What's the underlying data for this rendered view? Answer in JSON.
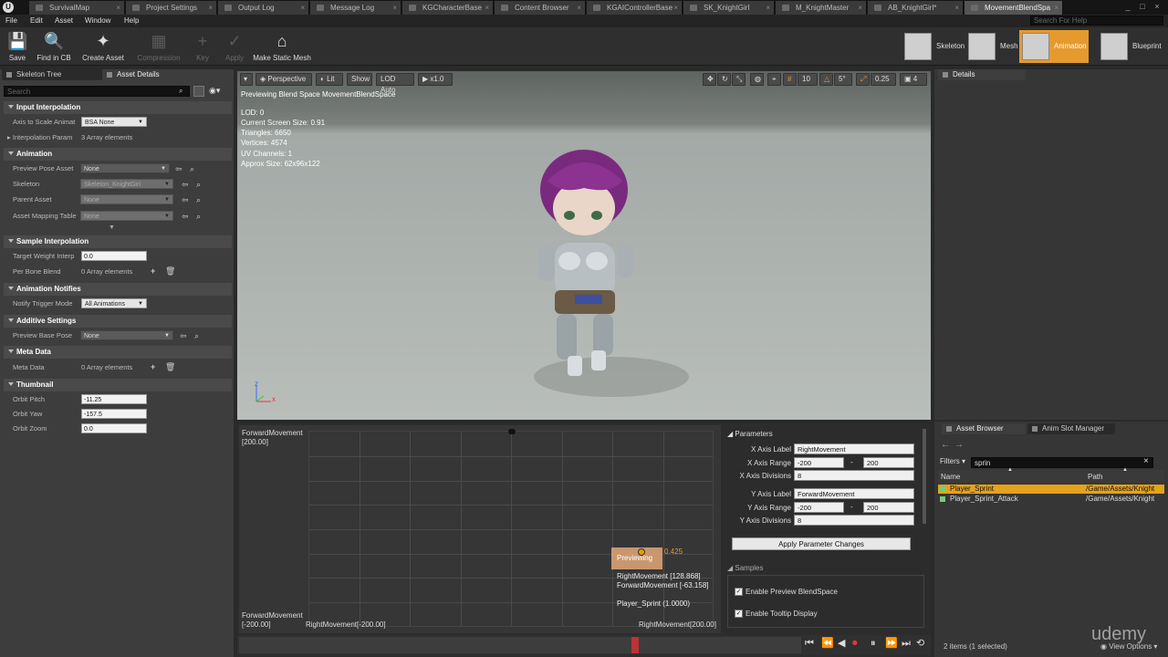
{
  "tabs": [
    {
      "label": "SurvivalMap"
    },
    {
      "label": "Project Settings"
    },
    {
      "label": "Output Log"
    },
    {
      "label": "Message Log"
    },
    {
      "label": "KGCharacterBase"
    },
    {
      "label": "Content Browser"
    },
    {
      "label": "KGAIControllerBase"
    },
    {
      "label": "SK_KnightGirl"
    },
    {
      "label": "M_KnightMaster"
    },
    {
      "label": "AB_KnightGirl*"
    },
    {
      "label": "MovementBlendSpa"
    }
  ],
  "search_for_help": "Search For Help",
  "menu": [
    "File",
    "Edit",
    "Asset",
    "Window",
    "Help"
  ],
  "toolbar": {
    "save": "Save",
    "find": "Find in CB",
    "create": "Create Asset",
    "compression": "Compression",
    "key": "Key",
    "apply": "Apply",
    "make_static": "Make Static Mesh"
  },
  "modes": {
    "skeleton": "Skeleton",
    "mesh": "Mesh",
    "animation": "Animation",
    "blueprint": "Blueprint"
  },
  "left_panel": {
    "tab_skeleton": "Skeleton Tree",
    "tab_details": "Asset Details",
    "search_placeholder": "Search",
    "cat_input": "Input Interpolation",
    "axis_scale": "Axis to Scale Animat",
    "axis_scale_val": "BSA None",
    "interp_param": "Interpolation Param",
    "interp_param_val": "3 Array elements",
    "cat_animation": "Animation",
    "preview_pose": "Preview Pose Asset",
    "preview_pose_val": "None",
    "skeleton": "Skeleton",
    "skeleton_val": "Skeleton_KnightGirl",
    "parent_asset": "Parent Asset",
    "parent_asset_val": "None",
    "asset_mapping": "Asset Mapping Table",
    "asset_mapping_val": "None",
    "cat_sample": "Sample Interpolation",
    "target_weight": "Target Weight Interp",
    "target_weight_val": "0.0",
    "per_bone": "Per Bone Blend",
    "per_bone_val": "0 Array elements",
    "cat_notifies": "Animation Notifies",
    "notify_mode": "Notify Trigger Mode",
    "notify_mode_val": "All Animations",
    "cat_additive": "Additive Settings",
    "preview_base": "Preview Base Pose",
    "preview_base_val": "None",
    "cat_meta": "Meta Data",
    "meta": "Meta Data",
    "meta_val": "0 Array elements",
    "cat_thumb": "Thumbnail",
    "orbit_pitch": "Orbit Pitch",
    "orbit_pitch_val": "-11.25",
    "orbit_yaw": "Orbit Yaw",
    "orbit_yaw_val": "-157.5",
    "orbit_zoom": "Orbit Zoom",
    "orbit_zoom_val": "0.0"
  },
  "viewport": {
    "perspective": "Perspective",
    "lit": "Lit",
    "show": "Show",
    "lod": "LOD Auto",
    "speed": "x1.0",
    "grid_snap": "10",
    "rot_snap": "5°",
    "scale_snap": "0.25",
    "cam_speed": "4",
    "preview_title": "Previewing Blend Space MovementBlendSpace",
    "stats": [
      "LOD: 0",
      "Current Screen Size: 0.91",
      "Triangles: 6650",
      "Vertices: 4574",
      "UV Channels: 1",
      "Approx Size: 62x96x122"
    ],
    "axis_z": "z",
    "axis_x": "x"
  },
  "blend_grid": {
    "y_top": "ForwardMovement",
    "y_top_val": "[200.00]",
    "y_bot": "ForwardMovement",
    "y_bot_val": "[-200.00]",
    "x_left": "RightMovement[-200.00]",
    "x_right": "RightMovement[200.00]",
    "previewing": "Previewing",
    "marker_val": "0.425",
    "tip_right": "RightMovement [128.868]",
    "tip_forward": "ForwardMovement [-63.158]",
    "tip_anim": "Player_Sprint (1.0000)"
  },
  "parameters": {
    "title": "Parameters",
    "x_label": "X Axis Label",
    "x_label_val": "RightMovement",
    "x_range": "X Axis Range",
    "x_min": "-200",
    "x_max": "200",
    "x_div": "X Axis Divisions",
    "x_div_val": "8",
    "y_label": "Y Axis Label",
    "y_label_val": "ForwardMovement",
    "y_range": "Y Axis Range",
    "y_min": "-200",
    "y_max": "200",
    "y_div": "Y Axis Divisions",
    "y_div_val": "8",
    "apply": "Apply Parameter Changes",
    "samples": "Samples",
    "enable_preview": "Enable Preview BlendSpace",
    "enable_tooltip": "Enable Tooltip Display",
    "dash": "-"
  },
  "details": {
    "tab": "Details"
  },
  "asset_browser": {
    "tab": "Asset Browser",
    "tab2": "Anim Slot Manager",
    "filters": "Filters",
    "search_val": "sprin",
    "col_name": "Name",
    "col_path": "Path",
    "rows": [
      {
        "name": "Player_Sprint",
        "path": "/Game/Assets/Knight"
      },
      {
        "name": "Player_Sprint_Attack",
        "path": "/Game/Assets/Knight"
      }
    ],
    "status": "2 items (1 selected)",
    "view_options": "View Options"
  },
  "watermark": "udemy"
}
